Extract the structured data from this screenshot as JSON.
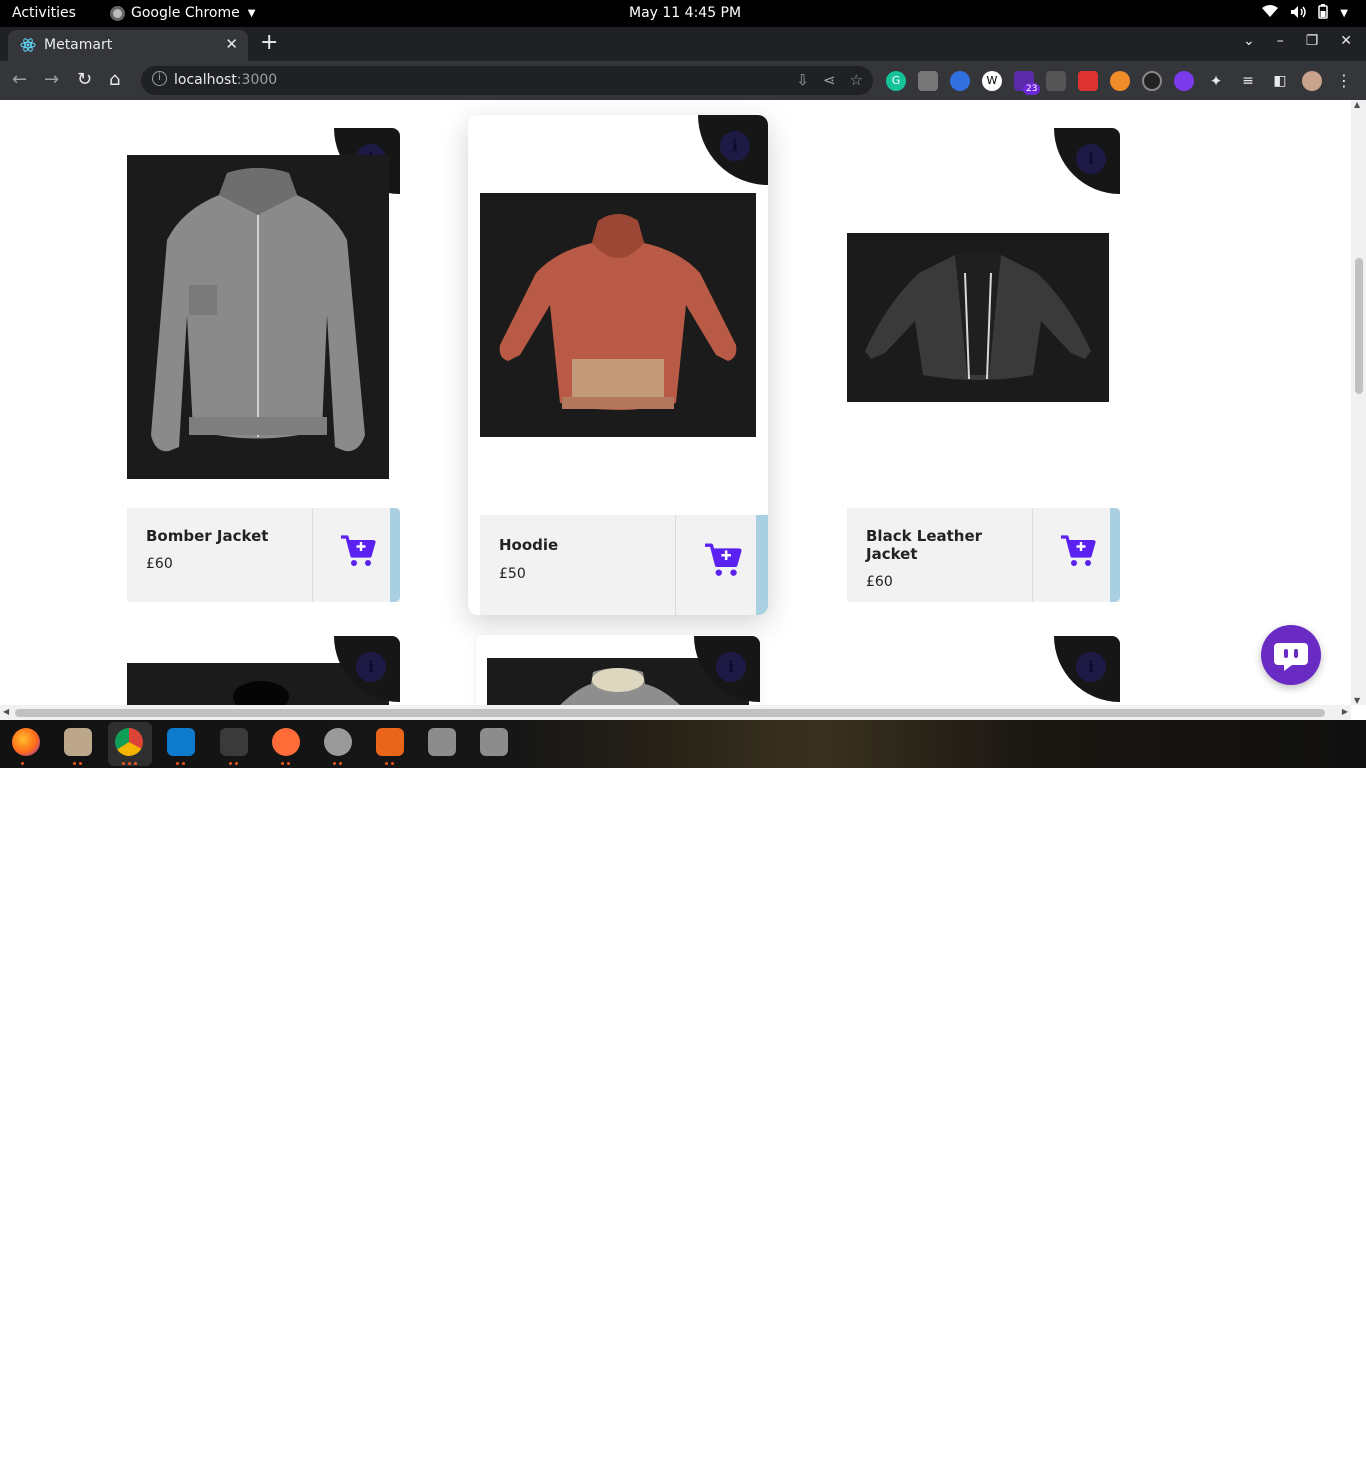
{
  "system_bar": {
    "activities": "Activities",
    "app_name": "Google Chrome",
    "clock": "May 11  4:45 PM"
  },
  "browser": {
    "tab_title": "Metamart",
    "url_host": "localhost",
    "url_port": ":3000",
    "extension_badge": "23"
  },
  "products": [
    {
      "name": "Bomber Jacket",
      "price": "£60"
    },
    {
      "name": "Hoodie",
      "price": "£50"
    },
    {
      "name_line1": "Black Leather",
      "name_line2": "Jacket",
      "price": "£60"
    }
  ],
  "colors": {
    "accent": "#6d28d9",
    "cart": "#5b21f0",
    "stripe": "#a9cfe3",
    "chat": "#6a2bc4"
  },
  "icons": {
    "info": "i",
    "close": "✕",
    "new_tab": "+"
  }
}
